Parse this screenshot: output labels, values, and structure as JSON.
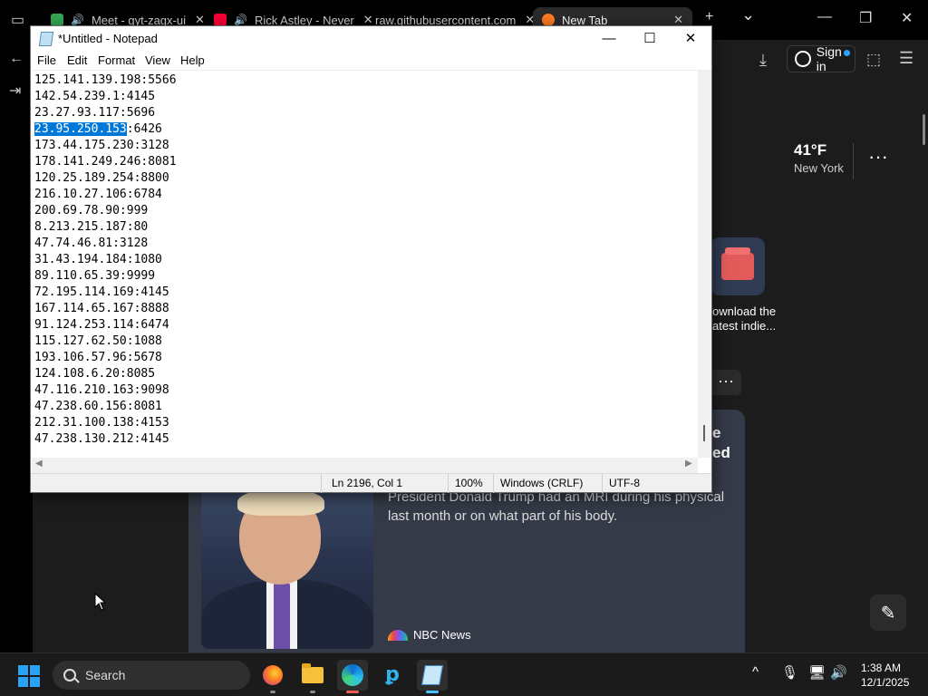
{
  "browser": {
    "tabs": [
      {
        "label": "Meet - gyt-zagx-ui",
        "color": "#34a853"
      },
      {
        "label": "Rick Astley - Never",
        "color": "#ff0033"
      },
      {
        "label": "raw.githubusercontent.com",
        "color": ""
      },
      {
        "label": "New Tab",
        "color": "#ff7b22"
      }
    ],
    "new_tab_glyph": "+",
    "tab_list_glyph": "⌄",
    "sign_in_label": "Sign in",
    "weather": {
      "temp": "41°F",
      "city": "New York",
      "more": "···"
    },
    "tile": {
      "line1": "ownload the",
      "line2": "atest indie..."
    },
    "feed_more": "···",
    "feed_card_right": {
      "line1": "e",
      "line2": "ed"
    },
    "news": {
      "line1": "President Donald Trump had an MRI during his physical",
      "line2": "last month or on what part of his body.",
      "source": "NBC News"
    },
    "edit_glyph": "✎"
  },
  "notepad": {
    "title": "*Untitled - Notepad",
    "menu": [
      "File",
      "Edit",
      "Format",
      "View",
      "Help"
    ],
    "lines": [
      {
        "sel": "",
        "rest": "125.141.139.198:5566"
      },
      {
        "sel": "",
        "rest": "142.54.239.1:4145"
      },
      {
        "sel": "",
        "rest": "23.27.93.117:5696"
      },
      {
        "sel": "23.95.250.153",
        "rest": ":6426"
      },
      {
        "sel": "",
        "rest": "173.44.175.230:3128"
      },
      {
        "sel": "",
        "rest": "178.141.249.246:8081"
      },
      {
        "sel": "",
        "rest": "120.25.189.254:8800"
      },
      {
        "sel": "",
        "rest": "216.10.27.106:6784"
      },
      {
        "sel": "",
        "rest": "200.69.78.90:999"
      },
      {
        "sel": "",
        "rest": "8.213.215.187:80"
      },
      {
        "sel": "",
        "rest": "47.74.46.81:3128"
      },
      {
        "sel": "",
        "rest": "31.43.194.184:1080"
      },
      {
        "sel": "",
        "rest": "89.110.65.39:9999"
      },
      {
        "sel": "",
        "rest": "72.195.114.169:4145"
      },
      {
        "sel": "",
        "rest": "167.114.65.167:8888"
      },
      {
        "sel": "",
        "rest": "91.124.253.114:6474"
      },
      {
        "sel": "",
        "rest": "115.127.62.50:1088"
      },
      {
        "sel": "",
        "rest": "193.106.57.96:5678"
      },
      {
        "sel": "",
        "rest": "124.108.6.20:8085"
      },
      {
        "sel": "",
        "rest": "47.116.210.163:9098"
      },
      {
        "sel": "",
        "rest": "47.238.60.156:8081"
      },
      {
        "sel": "",
        "rest": "212.31.100.138:4153"
      },
      {
        "sel": "",
        "rest": "47.238.130.212:4145"
      }
    ],
    "status": {
      "position": "Ln 2196, Col 1",
      "zoom": "100%",
      "line_ending": "Windows (CRLF)",
      "encoding": "UTF-8"
    },
    "selection_color": "#0078d7"
  },
  "taskbar": {
    "search_label": "Search",
    "clock_time": "1:38 AM",
    "clock_date": "12/1/2025",
    "accent": "#4cc2ff"
  }
}
